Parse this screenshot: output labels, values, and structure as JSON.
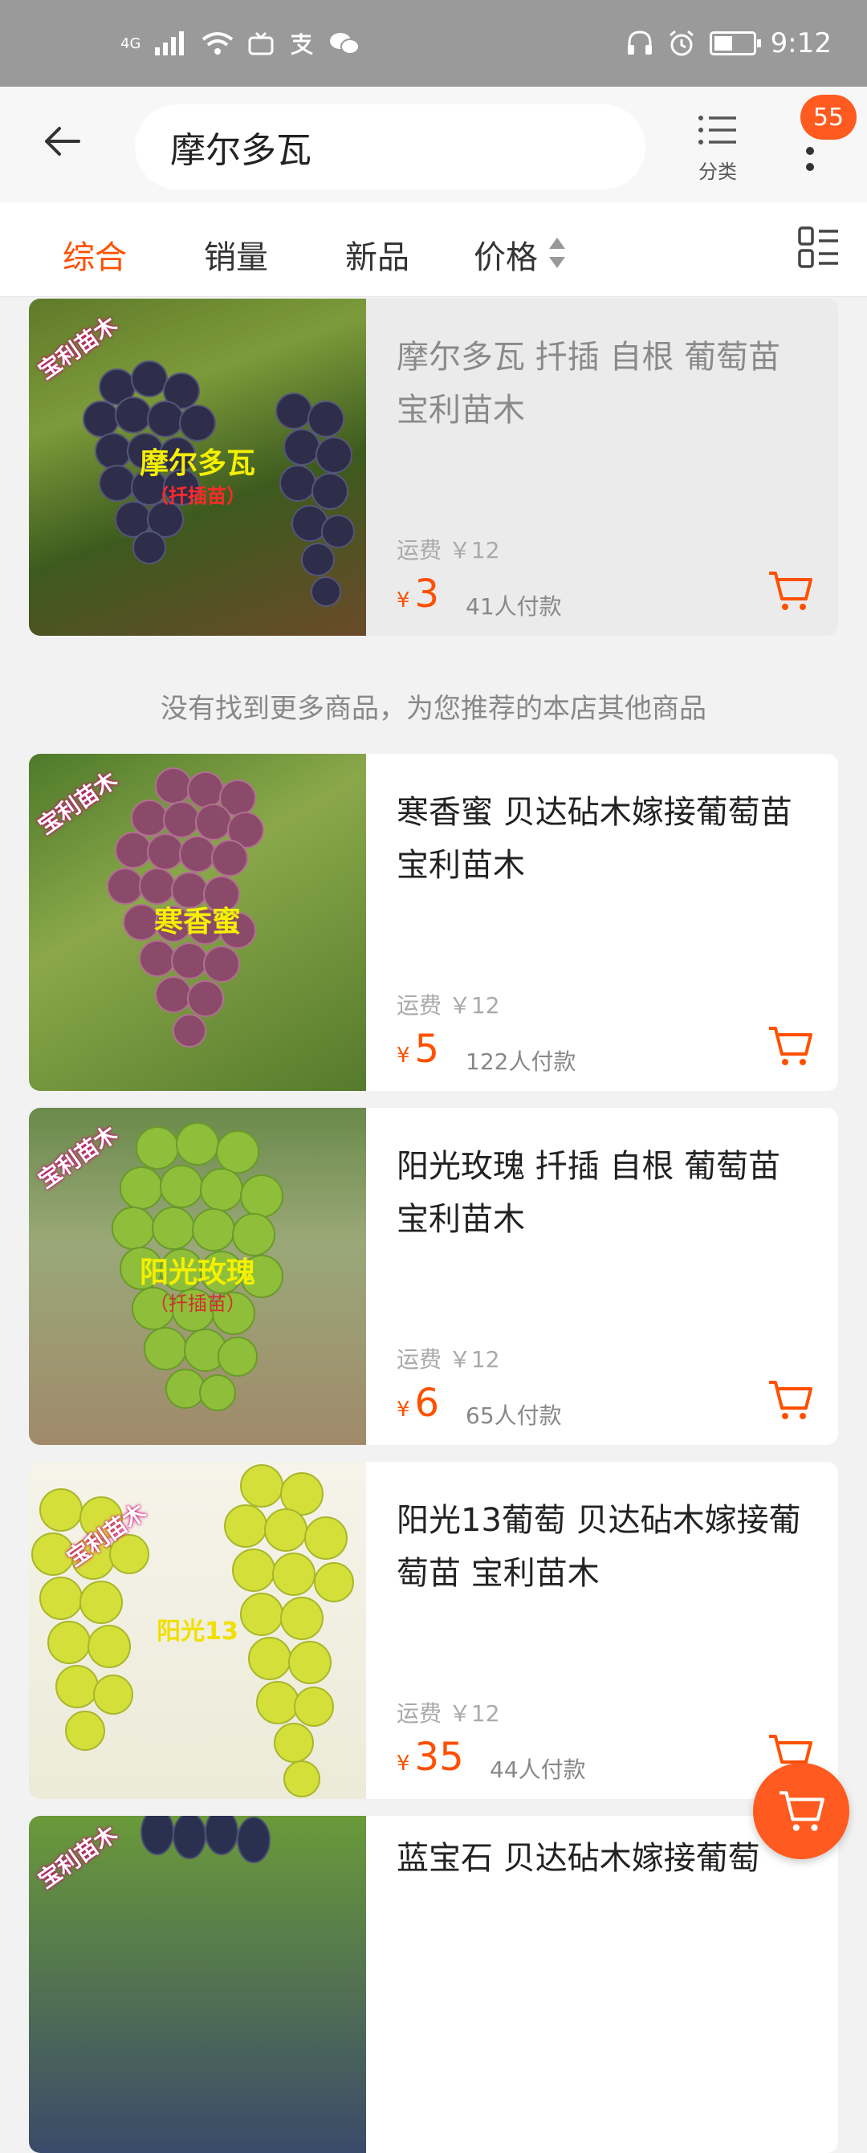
{
  "status": {
    "network": "4G",
    "time": "9:12"
  },
  "header": {
    "search_value": "摩尔多瓦",
    "category_label": "分类",
    "badge_count": "55"
  },
  "sort_tabs": {
    "overall": "综合",
    "sales": "销量",
    "new": "新品",
    "price": "价格"
  },
  "products": [
    {
      "title": "摩尔多瓦  扦插 自根 葡萄苗 宝利苗木",
      "shipping": "运费 ￥12",
      "currency": "¥",
      "price": "3",
      "sold": "41人付款",
      "image_label": "摩尔多瓦",
      "image_sub": "（扦插苗）",
      "image_brand": "宝利苗木"
    },
    {
      "title": "寒香蜜   贝达砧木嫁接葡萄苗 宝利苗木",
      "shipping": "运费 ￥12",
      "currency": "¥",
      "price": "5",
      "sold": "122人付款",
      "image_label": "寒香蜜",
      "image_brand": "宝利苗木"
    },
    {
      "title": "阳光玫瑰 扦插 自根 葡萄苗 宝利苗木",
      "shipping": "运费 ￥12",
      "currency": "¥",
      "price": "6",
      "sold": "65人付款",
      "image_label": "阳光玫瑰",
      "image_sub": "（扦插苗）",
      "image_brand": "宝利苗木"
    },
    {
      "title": "阳光13葡萄 贝达砧木嫁接葡萄苗 宝利苗木",
      "shipping": "运费 ￥12",
      "currency": "¥",
      "price": "35",
      "sold": "44人付款",
      "image_label": "阳光13",
      "image_brand": "宝利苗木"
    },
    {
      "title": "蓝宝石 贝达砧木嫁接葡萄",
      "image_brand": "宝利苗木"
    }
  ],
  "recommend_text": "没有找到更多商品，为您推荐的本店其他商品",
  "colors": {
    "accent": "#ff5000",
    "badge": "#ff5a1f",
    "statusbar": "#9a9a9a"
  }
}
